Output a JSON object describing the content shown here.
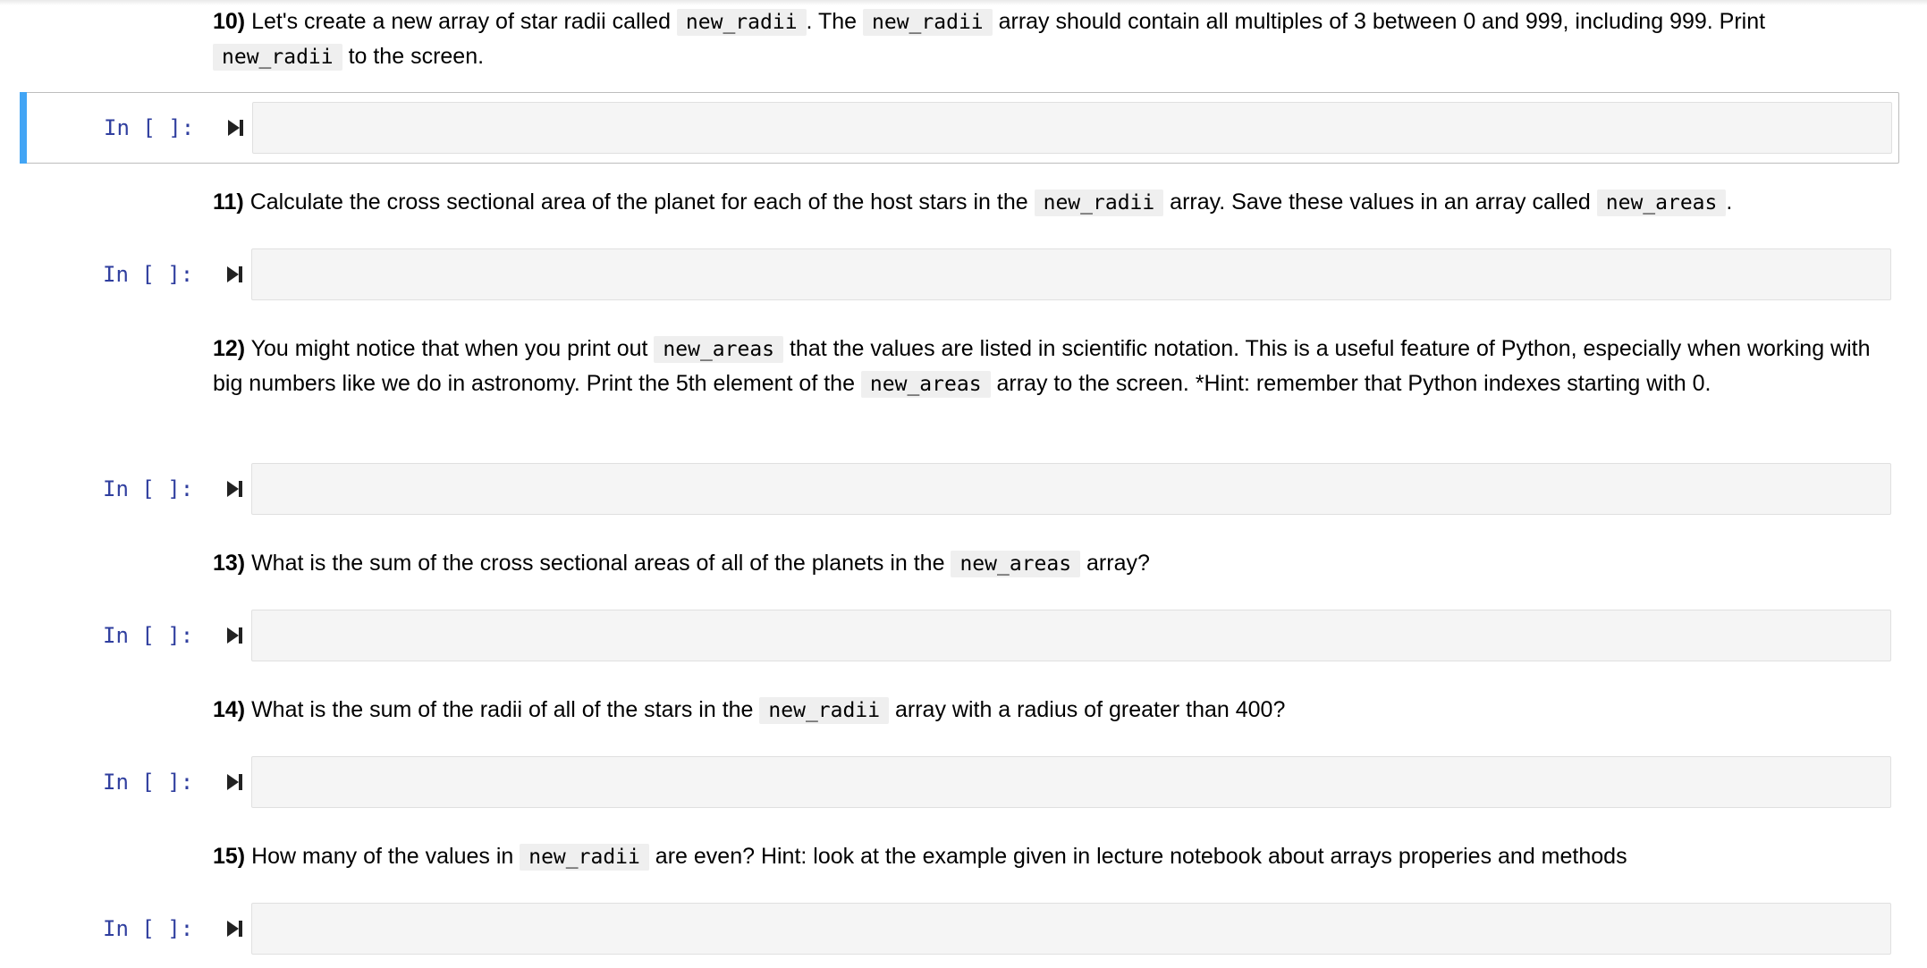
{
  "prompt_label": "In [ ]:",
  "cells": [
    {
      "number": "10)",
      "parts": [
        {
          "t": "text",
          "v": " Let's create a new array of star radii called "
        },
        {
          "t": "code",
          "v": "new_radii"
        },
        {
          "t": "text",
          "v": ". The "
        },
        {
          "t": "code",
          "v": "new_radii"
        },
        {
          "t": "text",
          "v": " array should contain all multiples of 3 between 0 and 999, including 999. Print "
        },
        {
          "t": "code",
          "v": "new_radii"
        },
        {
          "t": "text",
          "v": " to the screen."
        }
      ]
    },
    {
      "number": "11)",
      "parts": [
        {
          "t": "text",
          "v": " Calculate the cross sectional area of the planet for each of the host stars in the "
        },
        {
          "t": "code",
          "v": "new_radii"
        },
        {
          "t": "text",
          "v": " array. Save these values in an array called "
        },
        {
          "t": "code",
          "v": "new_areas"
        },
        {
          "t": "text",
          "v": "."
        }
      ]
    },
    {
      "number": "12)",
      "parts": [
        {
          "t": "text",
          "v": " You might notice that when you print out "
        },
        {
          "t": "code",
          "v": "new_areas"
        },
        {
          "t": "text",
          "v": " that the values are listed in scientific notation. This is a useful feature of Python, especially when working with big numbers like we do in astronomy. Print the 5th element of the "
        },
        {
          "t": "code",
          "v": "new_areas"
        },
        {
          "t": "text",
          "v": " array to the screen. *Hint: remember that Python indexes starting with 0."
        }
      ]
    },
    {
      "number": "13)",
      "parts": [
        {
          "t": "text",
          "v": " What is the sum of the cross sectional areas of all of the planets in the "
        },
        {
          "t": "code",
          "v": "new_areas"
        },
        {
          "t": "text",
          "v": " array?"
        }
      ]
    },
    {
      "number": "14)",
      "parts": [
        {
          "t": "text",
          "v": " What is the sum of the radii of all of the stars in the "
        },
        {
          "t": "code",
          "v": "new_radii"
        },
        {
          "t": "text",
          "v": " array with a radius of greater than 400?"
        }
      ]
    },
    {
      "number": "15)",
      "parts": [
        {
          "t": "text",
          "v": " How many of the values in "
        },
        {
          "t": "code",
          "v": "new_radii"
        },
        {
          "t": "text",
          "v": " are even? Hint: look at the example given in lecture notebook about arrays properies and methods"
        }
      ]
    }
  ]
}
